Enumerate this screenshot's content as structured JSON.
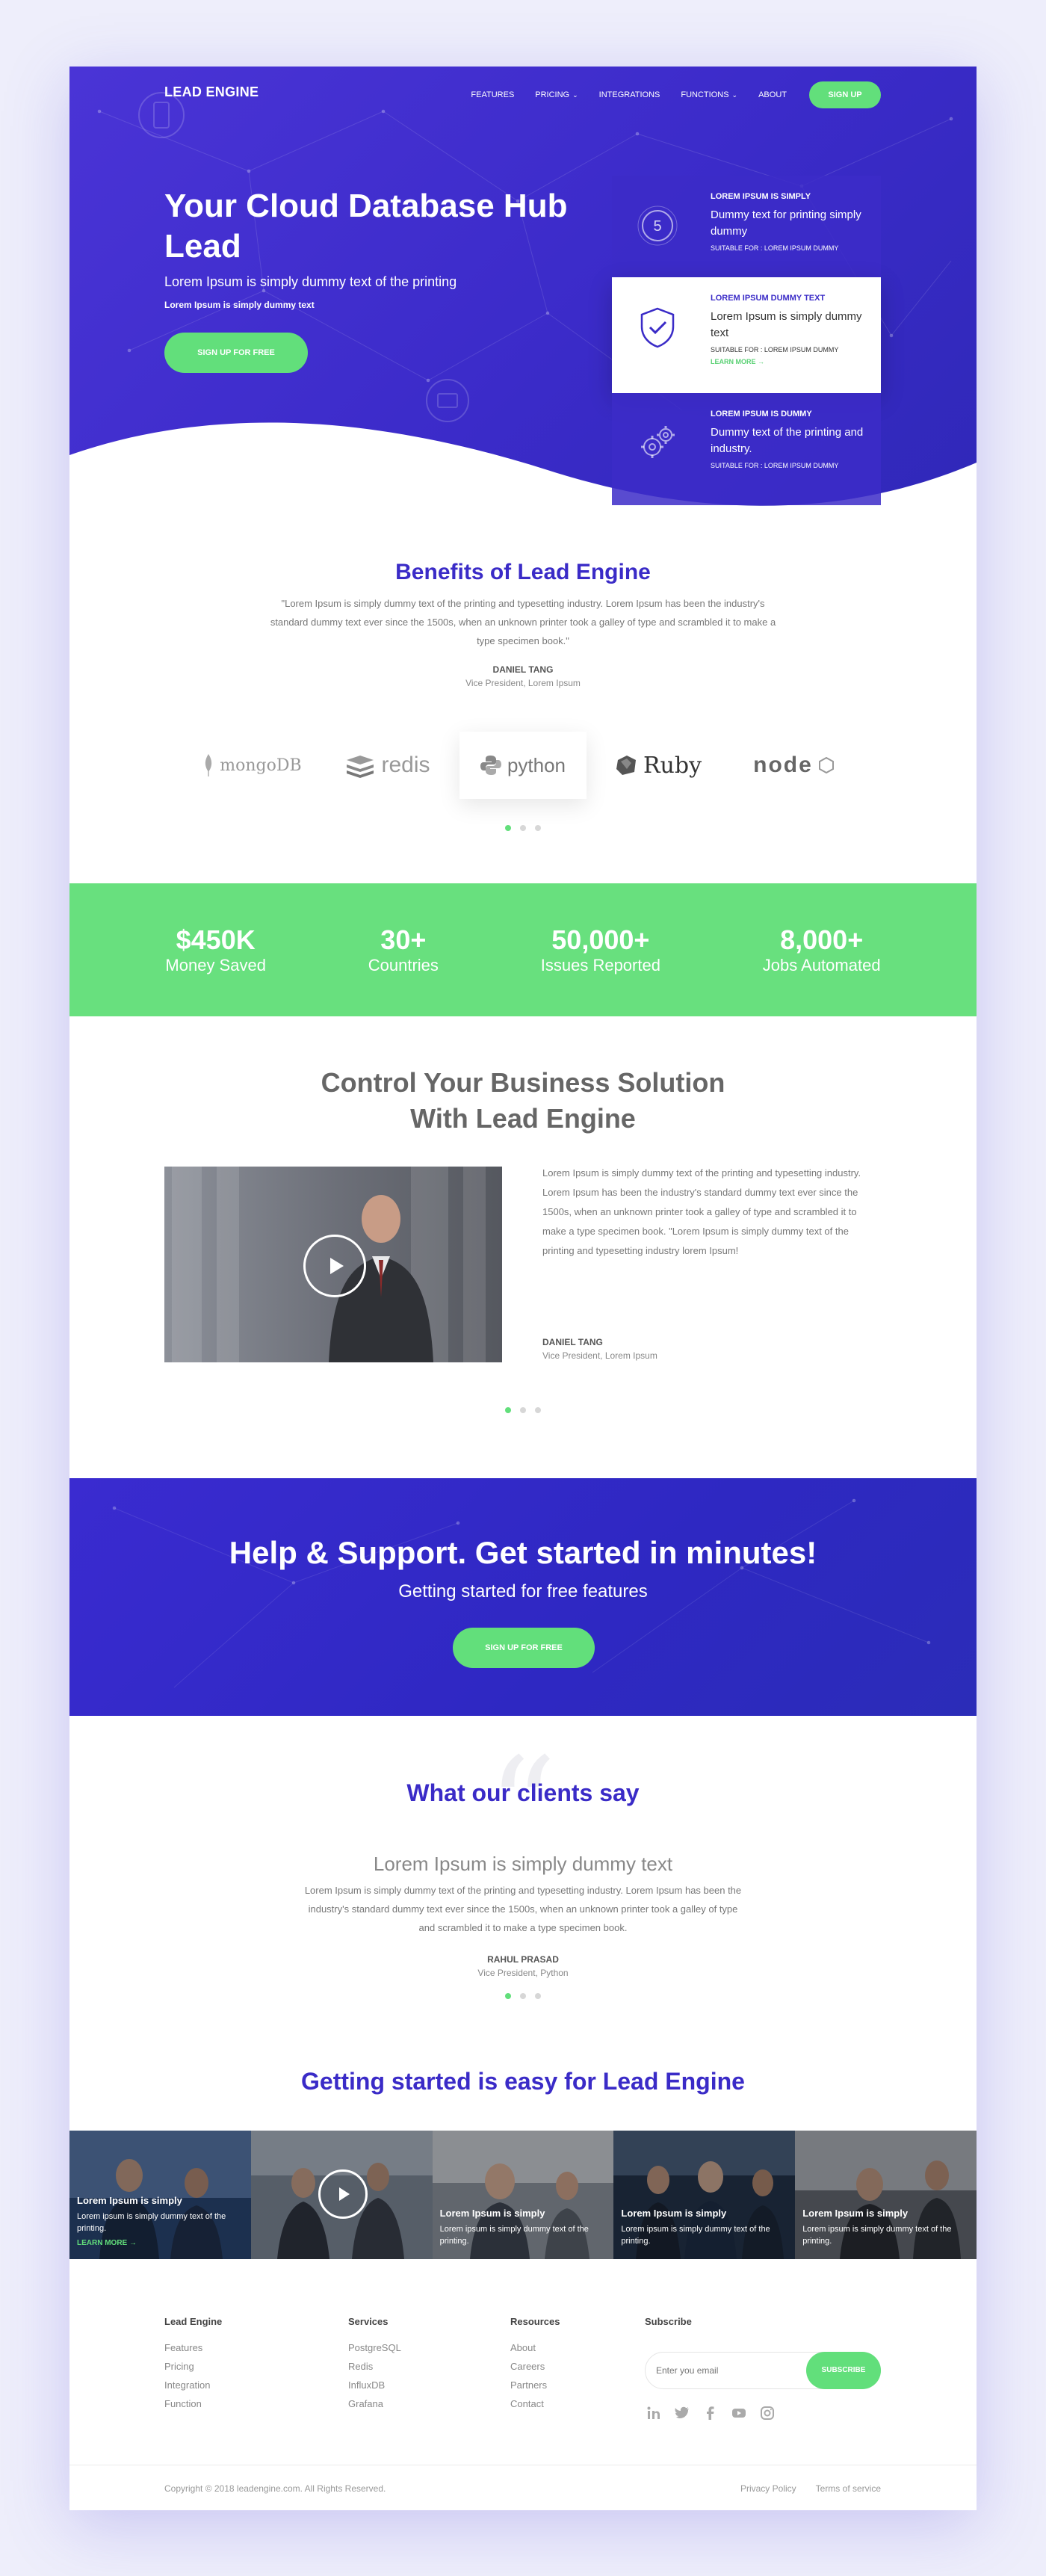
{
  "brand": {
    "logo": "LEAD ENGINE",
    "accent": "#3a2bc7",
    "green": "#62df7b"
  },
  "nav": {
    "items": [
      {
        "label": "FEATURES",
        "dropdown": false
      },
      {
        "label": "PRICING",
        "dropdown": true
      },
      {
        "label": "INTEGRATIONS",
        "dropdown": false
      },
      {
        "label": "FUNCTIONS",
        "dropdown": true
      },
      {
        "label": "ABOUT",
        "dropdown": false
      }
    ],
    "signup": "SIGN UP"
  },
  "hero": {
    "title": "Your Cloud Database Hub Lead",
    "subtitle": "Lorem Ipsum is simply dummy text of the printing",
    "subtitle2": "Lorem Ipsum is simply dummy text",
    "cta": "SIGN UP FOR FREE",
    "cards": [
      {
        "head": "LOREM IPSUM IS SIMPLY",
        "text": "Dummy text for printing simply dummy",
        "small": "SUITABLE FOR : LOREM IPSUM DUMMY",
        "icon": "five-circle-icon"
      },
      {
        "head": "LOREM IPSUM DUMMY TEXT",
        "text": "Lorem Ipsum is simply dummy text",
        "small": "SUITABLE FOR : LOREM IPSUM DUMMY",
        "more": "LEARN MORE →",
        "icon": "shield-check-icon"
      },
      {
        "head": "LOREM IPSUM IS DUMMY",
        "text": "Dummy text of the printing and industry.",
        "small": "SUITABLE FOR : LOREM IPSUM DUMMY",
        "icon": "gears-icon"
      }
    ]
  },
  "benefits": {
    "title": "Benefits of Lead Engine",
    "quote": "\"Lorem Ipsum is simply dummy text of the printing and typesetting industry. Lorem Ipsum has been the industry's standard dummy text ever since the 1500s, when an unknown printer took a galley of type and scrambled it to make a type specimen book.\"",
    "person_name": "DANIEL TANG",
    "person_role": "Vice President, Lorem Ipsum",
    "logos": [
      "mongoDB",
      "redis",
      "python",
      "Ruby",
      "node"
    ]
  },
  "stats": [
    {
      "value": "$450K",
      "label": "Money Saved"
    },
    {
      "value": "30+",
      "label": "Countries"
    },
    {
      "value": "50,000+",
      "label": "Issues Reported"
    },
    {
      "value": "8,000+",
      "label": "Jobs Automated"
    }
  ],
  "control": {
    "title_line1": "Control Your Business Solution",
    "title_line2": "With Lead Engine",
    "text": "Lorem Ipsum is simply dummy text of the printing and typesetting industry. Lorem Ipsum has been the industry's standard dummy text ever since the 1500s, when an unknown printer took a galley of type and scrambled it to make a type specimen book. \"Lorem Ipsum is simply dummy text of the printing and typesetting industry lorem Ipsum!",
    "person_name": "DANIEL TANG",
    "person_role": "Vice President, Lorem Ipsum"
  },
  "help": {
    "title": "Help & Support. Get started in minutes!",
    "subtitle": "Getting started for free features",
    "cta": "SIGN UP FOR FREE"
  },
  "clients": {
    "title": "What our clients say",
    "headline": "Lorem Ipsum is simply dummy text",
    "quote": "Lorem Ipsum is simply dummy text of the printing and typesetting industry. Lorem Ipsum has been the industry's standard dummy text ever since the 1500s, when an unknown printer took a galley of type and scrambled it to make a type specimen book.",
    "person_name": "RAHUL PRASAD",
    "person_role": "Vice President, Python"
  },
  "easy": {
    "title": "Getting started is easy for Lead Engine",
    "items": [
      {
        "title": "Lorem Ipsum is simply",
        "desc": "Lorem ipsum is simply dummy text of the printing.",
        "more": "LEARN MORE →"
      },
      {
        "title": "",
        "desc": "",
        "more": ""
      },
      {
        "title": "Lorem Ipsum is simply",
        "desc": "Lorem ipsum is simply dummy text of the printing.",
        "more": ""
      },
      {
        "title": "Lorem Ipsum is simply",
        "desc": "Lorem ipsum is simply dummy text of the printing.",
        "more": ""
      },
      {
        "title": "Lorem Ipsum is simply",
        "desc": "Lorem ipsum is simply dummy text of the printing.",
        "more": ""
      }
    ]
  },
  "footer": {
    "cols": [
      {
        "heading": "Lead Engine",
        "links": [
          "Features",
          "Pricing",
          "Integration",
          "Function"
        ]
      },
      {
        "heading": "Services",
        "links": [
          "PostgreSQL",
          "Redis",
          "InfluxDB",
          "Grafana"
        ]
      },
      {
        "heading": "Resources",
        "links": [
          "About",
          "Careers",
          "Partners",
          "Contact"
        ]
      }
    ],
    "subscribe_heading": "Subscribe",
    "email_placeholder": "Enter you email",
    "subscribe_btn": "SUBSCRIBE",
    "socials": [
      "linkedin-icon",
      "twitter-icon",
      "facebook-icon",
      "youtube-icon",
      "instagram-icon"
    ],
    "copyright": "Copyright © 2018 leadengine.com. All Rights Reserved.",
    "privacy": "Privacy Policy",
    "terms": "Terms of service"
  }
}
